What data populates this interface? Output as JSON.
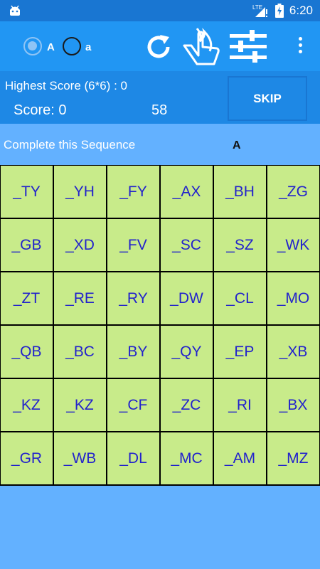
{
  "status_bar": {
    "time": "6:20",
    "network": "LTE",
    "battery_level": "charging",
    "icons": [
      "android-debug-icon",
      "signal-icon",
      "battery-icon"
    ]
  },
  "toolbar": {
    "radio_uppercase": {
      "label": "A",
      "selected": true
    },
    "radio_lowercase": {
      "label": "a",
      "selected": false
    },
    "icons": [
      "refresh-icon",
      "fire-hand-icon",
      "settings-sliders-icon",
      "overflow-menu-icon"
    ]
  },
  "scoreboard": {
    "highest_score": "Highest Score (6*6) : 0",
    "score": "Score: 0",
    "timer": "58",
    "skip_label": "SKIP"
  },
  "sequence": {
    "label": "Complete this Sequence",
    "target": "A"
  },
  "grid": {
    "rows": 6,
    "cols": 6,
    "cells": [
      "_TY",
      "_YH",
      "_FY",
      "_AX",
      "_BH",
      "_ZG",
      "_GB",
      "_XD",
      "_FV",
      "_SC",
      "_SZ",
      "_WK",
      "_ZT",
      "_RE",
      "_RY",
      "_DW",
      "_CL",
      "_MO",
      "_QB",
      "_BC",
      "_BY",
      "_QY",
      "_EP",
      "_XB",
      "_KZ",
      "_KZ",
      "_CF",
      "_ZC",
      "_RI",
      "_BX",
      "_GR",
      "_WB",
      "_DL",
      "_MC",
      "_AM",
      "_MZ"
    ]
  },
  "colors": {
    "status_bar": "#1976d2",
    "toolbar": "#2196f3",
    "background": "#63b1ff",
    "cell": "#c8eb8a",
    "cell_text": "#2222cc"
  }
}
